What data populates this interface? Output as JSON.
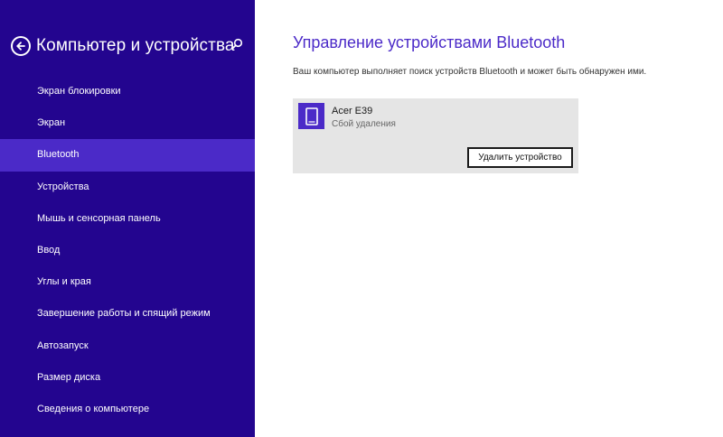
{
  "colors": {
    "sidebar_bg": "#23058f",
    "sidebar_active": "#4b2ac8",
    "accent": "#4b2ac8",
    "card_bg": "#e5e5e5"
  },
  "sidebar": {
    "title": "Компьютер и устройства",
    "back_icon": "back-arrow-icon",
    "search_icon": "search-icon",
    "items": [
      {
        "label": "Экран блокировки",
        "active": false
      },
      {
        "label": "Экран",
        "active": false
      },
      {
        "label": "Bluetooth",
        "active": true
      },
      {
        "label": "Устройства",
        "active": false
      },
      {
        "label": "Мышь и сенсорная панель",
        "active": false
      },
      {
        "label": "Ввод",
        "active": false
      },
      {
        "label": "Углы и края",
        "active": false
      },
      {
        "label": "Завершение работы и спящий режим",
        "active": false
      },
      {
        "label": "Автозапуск",
        "active": false
      },
      {
        "label": "Размер диска",
        "active": false
      },
      {
        "label": "Сведения о компьютере",
        "active": false
      }
    ]
  },
  "main": {
    "title": "Управление устройствами Bluetooth",
    "description": "Ваш компьютер выполняет поиск устройств Bluetooth и может быть обнаружен ими.",
    "device": {
      "name": "Acer E39",
      "status": "Сбой удаления",
      "icon": "phone-icon",
      "remove_label": "Удалить устройство"
    }
  }
}
